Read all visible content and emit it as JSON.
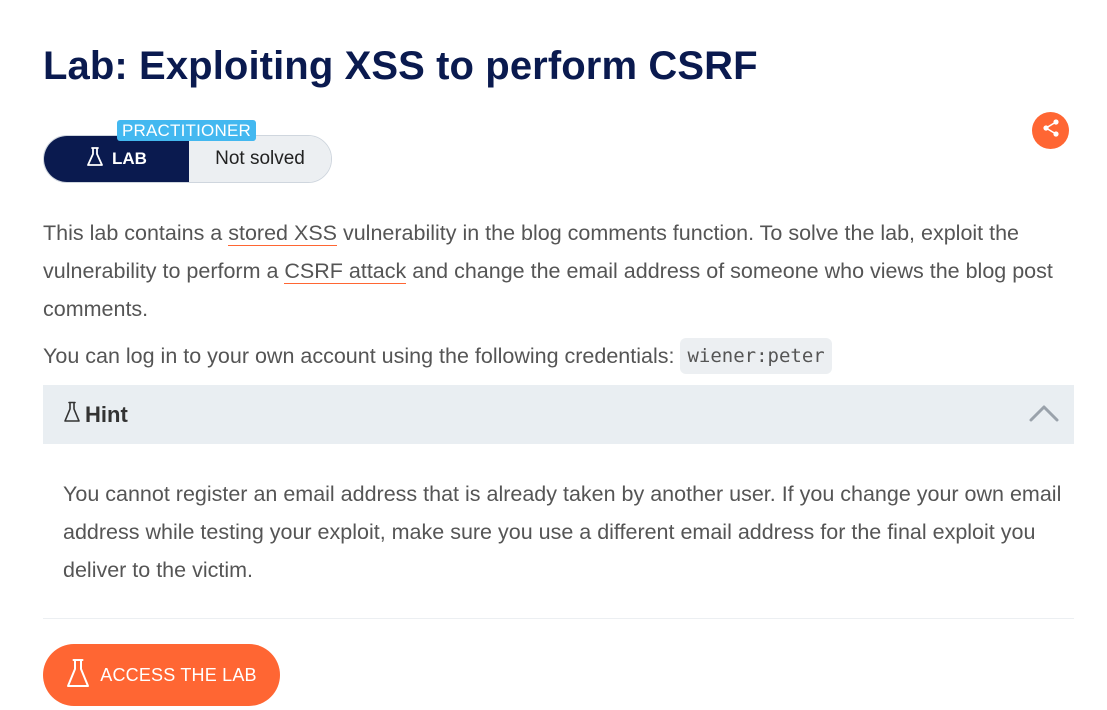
{
  "title": "Lab: Exploiting XSS to perform CSRF",
  "badge": {
    "level": "PRACTITIONER",
    "lab_label": "LAB",
    "status": "Not solved",
    "lab_icon": "flask-icon"
  },
  "share": {
    "icon": "share-icon",
    "color": "#ff6633"
  },
  "description": {
    "part1": "This lab contains a ",
    "link1": "stored XSS",
    "part2": " vulnerability in the blog comments function. To solve the lab, exploit the vulnerability to perform a ",
    "link2": "CSRF attack",
    "part3": " and change the email address of someone who views the blog post comments."
  },
  "credentials": {
    "text": "You can log in to your own account using the following credentials:",
    "value": "wiener:peter"
  },
  "hint": {
    "label": "Hint",
    "icon": "flask-icon",
    "expanded": true,
    "body": "You cannot register an email address that is already taken by another user. If you change your own email address while testing your exploit, make sure you use a different email address for the final exploit you deliver to the victim."
  },
  "access_button": {
    "label": "ACCESS THE LAB",
    "icon": "flask-icon"
  },
  "colors": {
    "accent": "#ff6633",
    "navy": "#0a1a4f",
    "practitioner": "#43b8f0"
  }
}
